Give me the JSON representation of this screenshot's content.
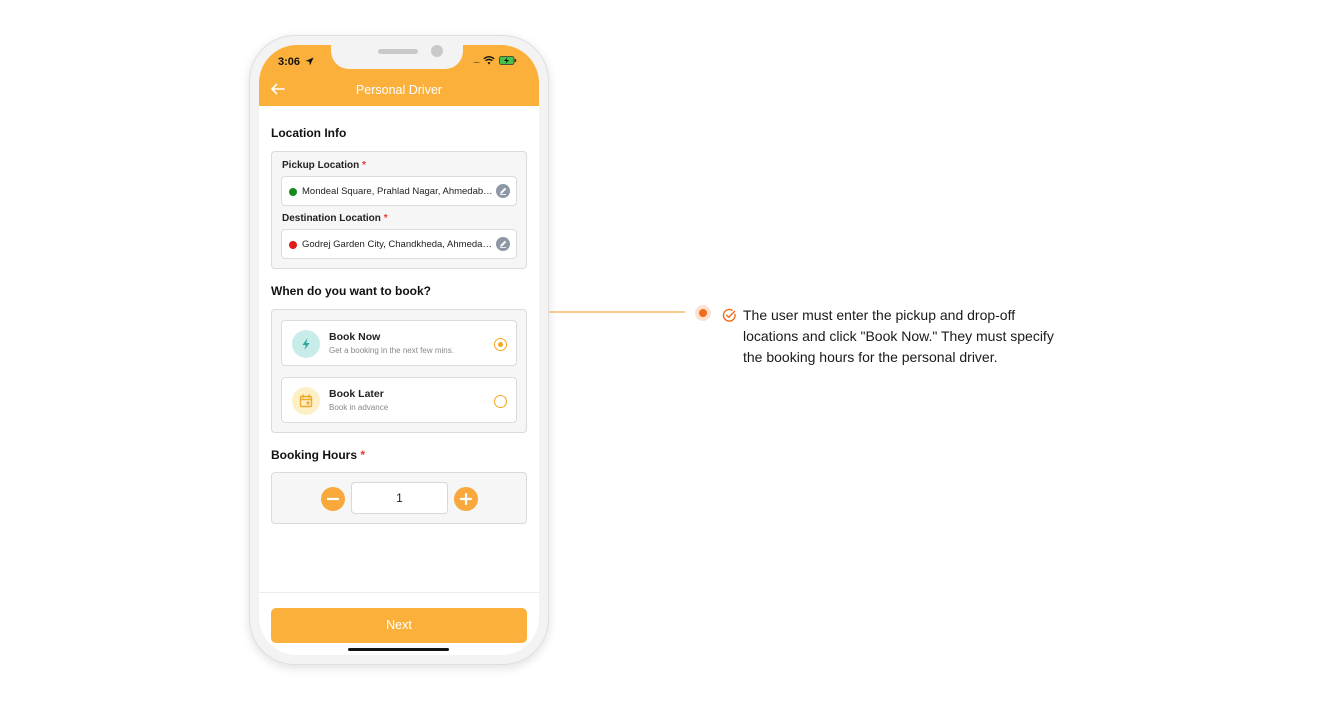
{
  "status_bar": {
    "time": "3:06"
  },
  "header": {
    "title": "Personal Driver"
  },
  "location_info": {
    "title": "Location Info",
    "pickup_label": "Pickup Location",
    "pickup_value": "Mondeal Square, Prahlad Nagar, Ahmedabad, Gujarat, India",
    "destination_label": "Destination Location",
    "destination_value": "Godrej Garden City, Chandkheda, Ahmedabad, Gujarat, India",
    "required_mark": "*",
    "pickup_dot_color": "#1a8a1a",
    "destination_dot_color": "#e01b1b"
  },
  "booking_time": {
    "title": "When do you want to book?",
    "options": [
      {
        "title": "Book Now",
        "subtitle": "Get a booking in the next few mins.",
        "selected": true
      },
      {
        "title": "Book Later",
        "subtitle": "Book in advance",
        "selected": false
      }
    ]
  },
  "booking_hours": {
    "title": "Booking Hours",
    "required_mark": "*",
    "value": "1"
  },
  "footer": {
    "next_label": "Next"
  },
  "annotation": {
    "text": "The user must enter the pickup and drop-off locations and click \"Book Now.\" They must specify the booking hours for the personal driver."
  },
  "colors": {
    "accent": "#fbb03b",
    "annotation_dot": "#f26b1d"
  }
}
